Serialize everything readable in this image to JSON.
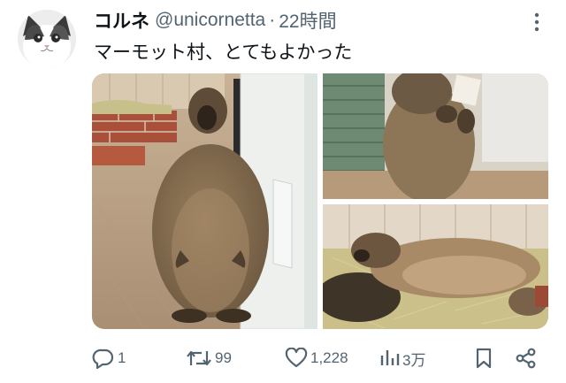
{
  "tweet": {
    "display_name": "コルネ",
    "handle": "@unicornetta",
    "separator": "·",
    "time": "22時間",
    "text": "マーモット村、とてもよかった"
  },
  "icons": {
    "avatar": "cat-avatar",
    "more": "more-vertical-icon",
    "reply": "reply-icon",
    "retweet": "retweet-icon",
    "like": "heart-icon",
    "views": "bar-chart-icon",
    "bookmark": "bookmark-icon",
    "share": "share-icon"
  },
  "metrics": {
    "replies": "1",
    "retweets": "99",
    "likes": "1,228",
    "views": "3万"
  },
  "colors": {
    "text": "#0f1419",
    "secondary": "#536471"
  }
}
